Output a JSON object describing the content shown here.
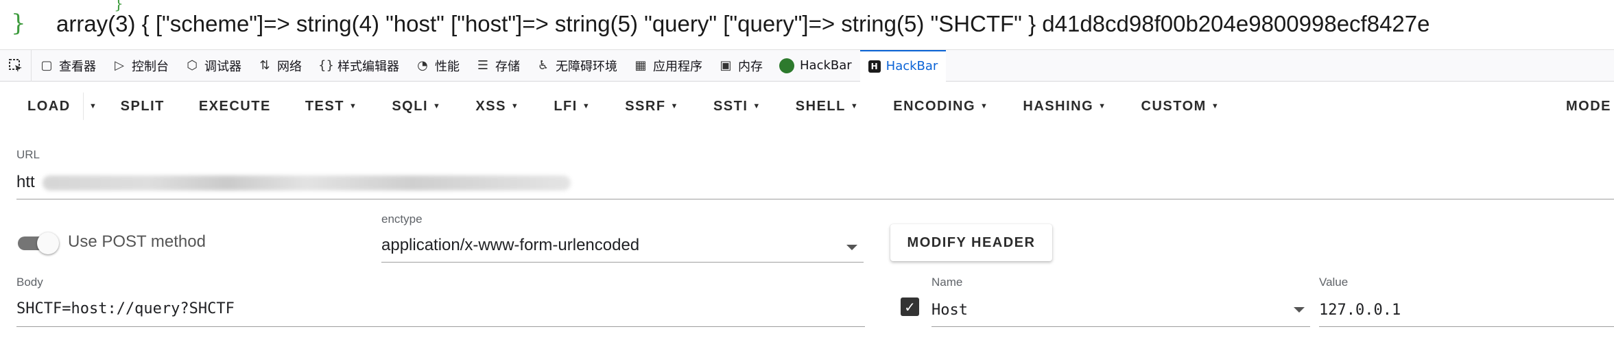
{
  "output": {
    "brace": "}",
    "tick": "}",
    "text": "array(3) { [\"scheme\"]=> string(4) \"host\" [\"host\"]=> string(5) \"query\" [\"query\"]=> string(5) \"SHCTF\" } d41d8cd98f00b204e9800998ecf8427e"
  },
  "devtools": {
    "tabs": [
      {
        "label": "查看器",
        "icon": "inspector-icon"
      },
      {
        "label": "控制台",
        "icon": "console-icon"
      },
      {
        "label": "调试器",
        "icon": "debugger-icon"
      },
      {
        "label": "网络",
        "icon": "network-icon"
      },
      {
        "label": "样式编辑器",
        "icon": "style-editor-icon"
      },
      {
        "label": "性能",
        "icon": "performance-icon"
      },
      {
        "label": "存储",
        "icon": "storage-icon"
      },
      {
        "label": "无障碍环境",
        "icon": "accessibility-icon"
      },
      {
        "label": "应用程序",
        "icon": "application-icon"
      },
      {
        "label": "内存",
        "icon": "memory-icon"
      },
      {
        "label": "HackBar",
        "icon": "hackbar-green-icon"
      },
      {
        "label": "HackBar",
        "icon": "hackbar-dark-icon"
      }
    ],
    "active_tab": "HackBar",
    "accent_color": "#0a63d6"
  },
  "menu": {
    "load": "LOAD",
    "split": "SPLIT",
    "execute": "EXECUTE",
    "test": "TEST",
    "sqli": "SQLI",
    "xss": "XSS",
    "lfi": "LFI",
    "ssrf": "SSRF",
    "ssti": "SSTI",
    "shell": "SHELL",
    "encoding": "ENCODING",
    "hashing": "HASHING",
    "custom": "CUSTOM",
    "mode": "MODE"
  },
  "url": {
    "label": "URL",
    "value_visible": "htt"
  },
  "post": {
    "toggle_label": "Use POST method",
    "enabled": true
  },
  "enctype": {
    "label": "enctype",
    "value": "application/x-www-form-urlencoded"
  },
  "modify_header": {
    "label": "MODIFY HEADER"
  },
  "body": {
    "label": "Body",
    "value": "SHCTF=host://query?SHCTF"
  },
  "header": {
    "name_label": "Name",
    "name_value": "Host",
    "value_label": "Value",
    "value_value": "127.0.0.1",
    "checked": true
  }
}
